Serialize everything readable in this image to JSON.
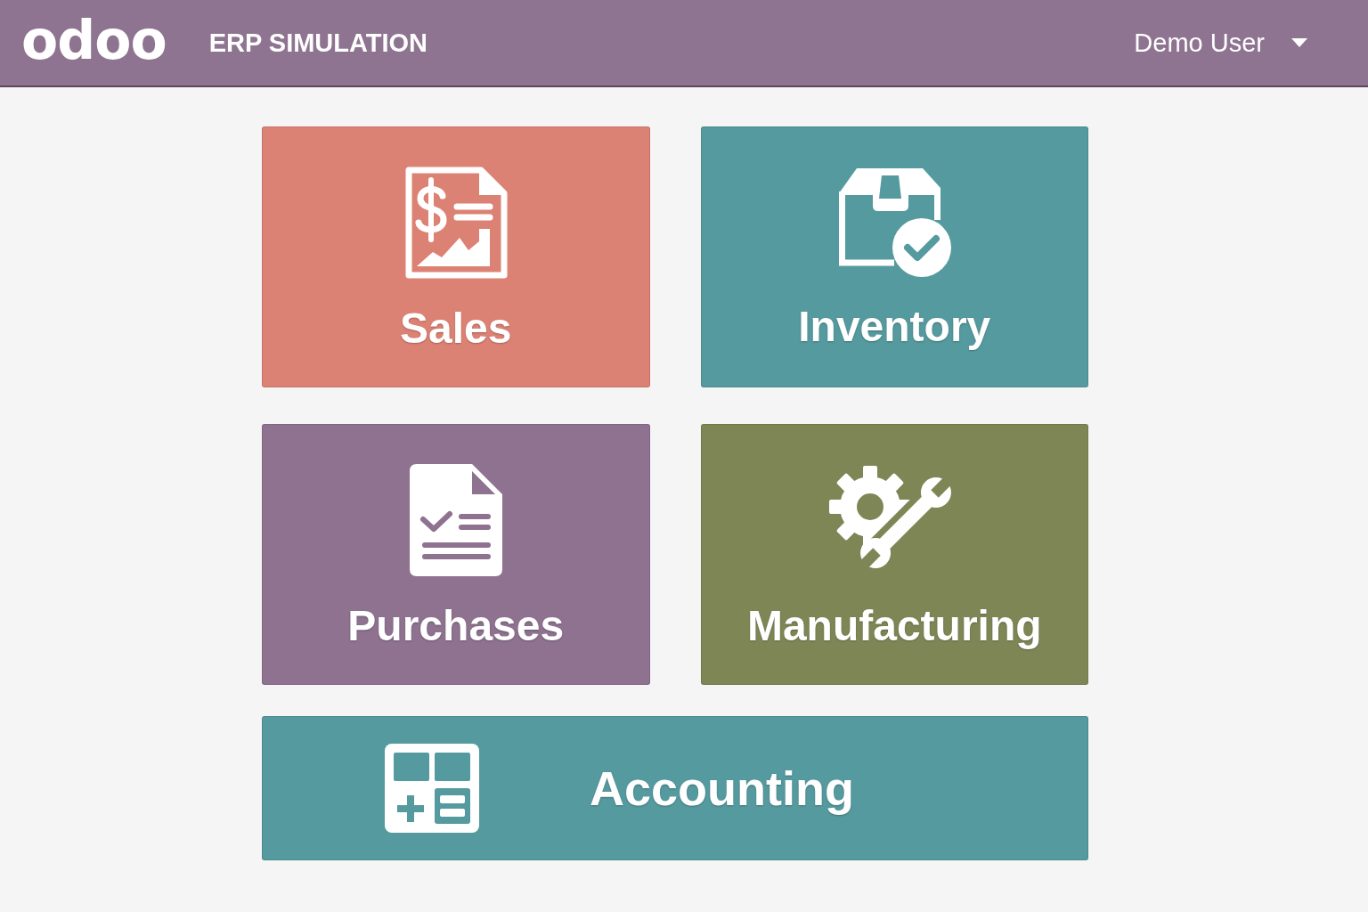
{
  "header": {
    "logo": "odoo",
    "title": "ERP SIMULATION",
    "user_menu": {
      "label": "Demo User"
    }
  },
  "apps": [
    {
      "kind": "tile",
      "label": "Sales",
      "color": "#dc8274"
    },
    {
      "kind": "tile",
      "label": "Inventory",
      "color": "#559a9f"
    },
    {
      "kind": "tile",
      "label": "Purchases",
      "color": "#8e7290"
    },
    {
      "kind": "tile",
      "label": "Manufacturing",
      "color": "#7f8656"
    },
    {
      "kind": "wide",
      "label": "Accounting",
      "color": "#559a9f"
    }
  ]
}
